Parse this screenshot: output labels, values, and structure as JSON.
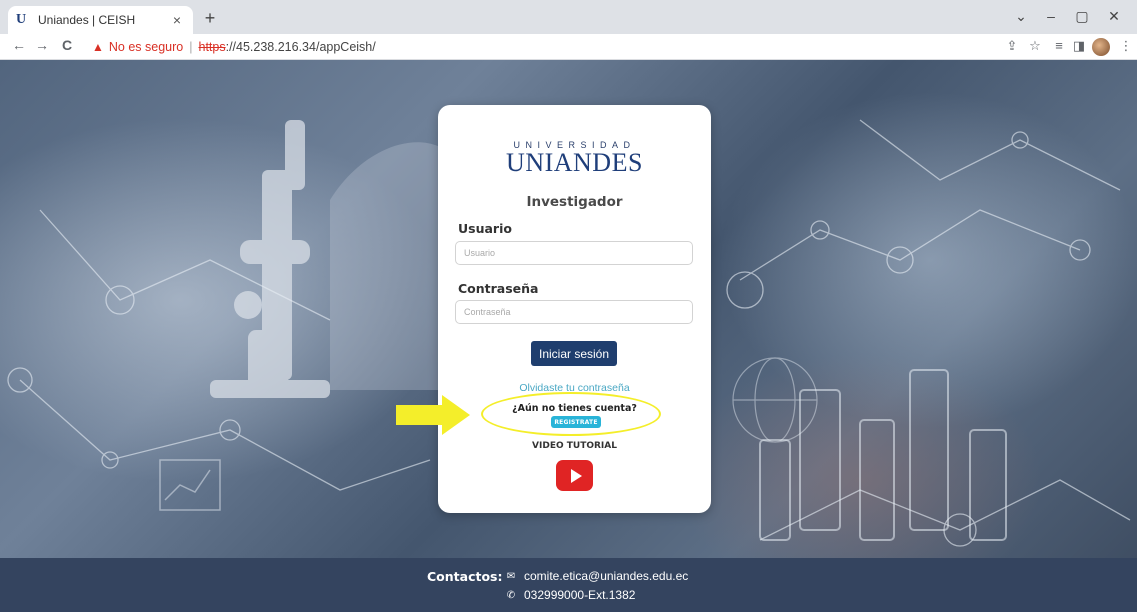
{
  "browser": {
    "tab_title": "Uniandes | CEISH",
    "tab_favicon": "U",
    "tab_close": "×",
    "new_tab": "+",
    "security_label": "No es seguro",
    "url_scheme": "https",
    "url_rest": "://45.238.216.34/appCeish/",
    "separator": "|",
    "glyphs": {
      "back": "←",
      "forward": "→",
      "reload": "C",
      "warning": "▲",
      "share": "⇪",
      "star": "☆",
      "reading": "≡",
      "sidepanel": "◨",
      "menu": "⋮",
      "minimize": "–",
      "restore": "▢",
      "close": "✕",
      "tabs-dropdown": "⌄"
    }
  },
  "login": {
    "logo_sub": "UNIVERSIDAD",
    "logo_main": "UNIANDES",
    "role": "Investigador",
    "user_label": "Usuario",
    "user_placeholder": "Usuario",
    "password_label": "Contraseña",
    "password_placeholder": "Contraseña",
    "submit_label": "Iniciar sesión",
    "forgot_link": "Olvidaste tu contraseña",
    "no_account": "¿Aún no tienes cuenta?",
    "register_label": "REGISTRATE",
    "video_label": "VIDEO TUTORIAL"
  },
  "footer": {
    "contacts_label": "Contactos:",
    "email": "comite.etica@uniandes.edu.ec",
    "phone": "032999000-Ext.1382",
    "email_icon": "✉",
    "phone_icon": "✆"
  },
  "colors": {
    "brand_navy": "#1f3e6e",
    "register_cyan": "#29b4d8",
    "youtube_red": "#e02424",
    "annotation_yellow": "#f4ee2a",
    "footer_bg": "#34445f",
    "insecure_red": "#d93025"
  }
}
